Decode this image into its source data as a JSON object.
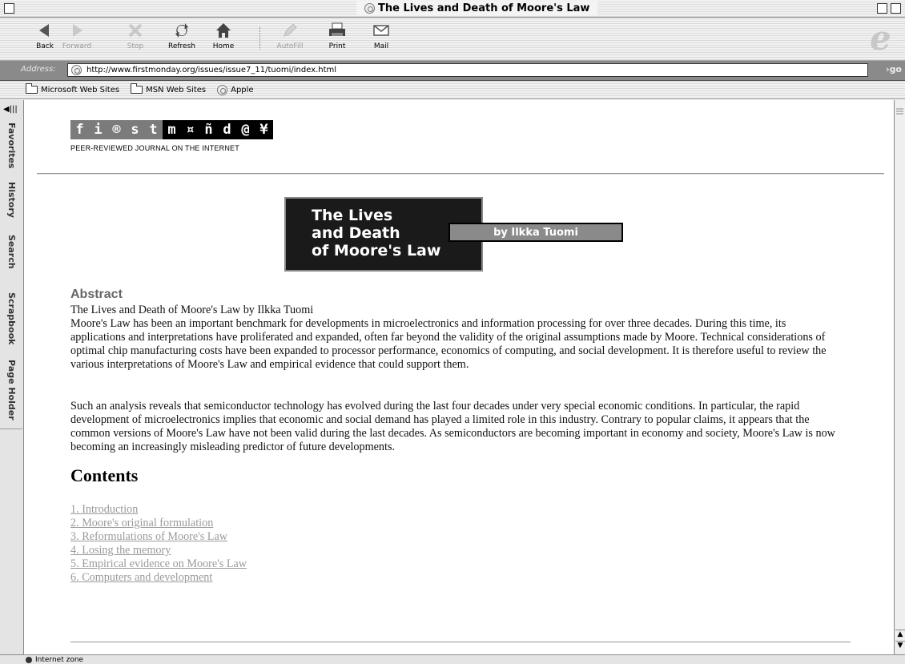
{
  "window": {
    "title": "The Lives and Death of Moore's Law"
  },
  "toolbar": {
    "back": "Back",
    "forward": "Forward",
    "stop": "Stop",
    "refresh": "Refresh",
    "home": "Home",
    "autofill": "AutoFill",
    "print": "Print",
    "mail": "Mail"
  },
  "address": {
    "label": "Address:",
    "url": "http://www.firstmonday.org/issues/issue7_11/tuomi/index.html",
    "go": "go"
  },
  "favorites": {
    "items": [
      "Microsoft Web Sites",
      "MSN Web Sites",
      "Apple"
    ]
  },
  "sidebar": {
    "tabs": [
      "Favorites",
      "History",
      "Search",
      "Scrapbook",
      "Page Holder"
    ]
  },
  "page": {
    "logo_letters": [
      "f",
      "i",
      "®",
      "s",
      "t",
      "m",
      "¤",
      "ñ",
      "d",
      "@",
      "¥"
    ],
    "tagline": "PEER-REVIEWED JOURNAL ON THE INTERNET",
    "banner_title_1": "The Lives",
    "banner_title_2": "and Death",
    "banner_title_3": "of Moore's Law",
    "byline": "by Ilkka Tuomi",
    "abstract_heading": "Abstract",
    "abstract_line": "The Lives and Death of Moore's Law by Ilkka Tuomi",
    "abstract_p1": "Moore's Law has been an important benchmark for developments in microelectronics and information processing for over three decades. During this time, its applications and interpretations have proliferated and expanded, often far beyond the validity of the original assumptions made by Moore. Technical considerations of optimal chip manufacturing costs have been expanded to processor performance, economics of computing, and social development. It is therefore useful to review the various interpretations of Moore's Law and empirical evidence that could support them.",
    "abstract_p2": "Such an analysis reveals that semiconductor technology has evolved during the last four decades under very special economic conditions. In particular, the rapid development of microelectronics implies that economic and social demand has played a limited role in this industry. Contrary to popular claims, it appears that the common versions of Moore's Law have not been valid during the last decades. As semiconductors are becoming important in economy and society, Moore's Law is now becoming an increasingly misleading predictor of future developments.",
    "contents_heading": "Contents",
    "toc": [
      "1. Introduction",
      "2. Moore's original formulation",
      "3. Reformulations of Moore's Law",
      "4. Losing the memory",
      "5. Empirical evidence on Moore's Law",
      "6. Computers and development"
    ]
  },
  "status": {
    "zone": "Internet zone"
  }
}
